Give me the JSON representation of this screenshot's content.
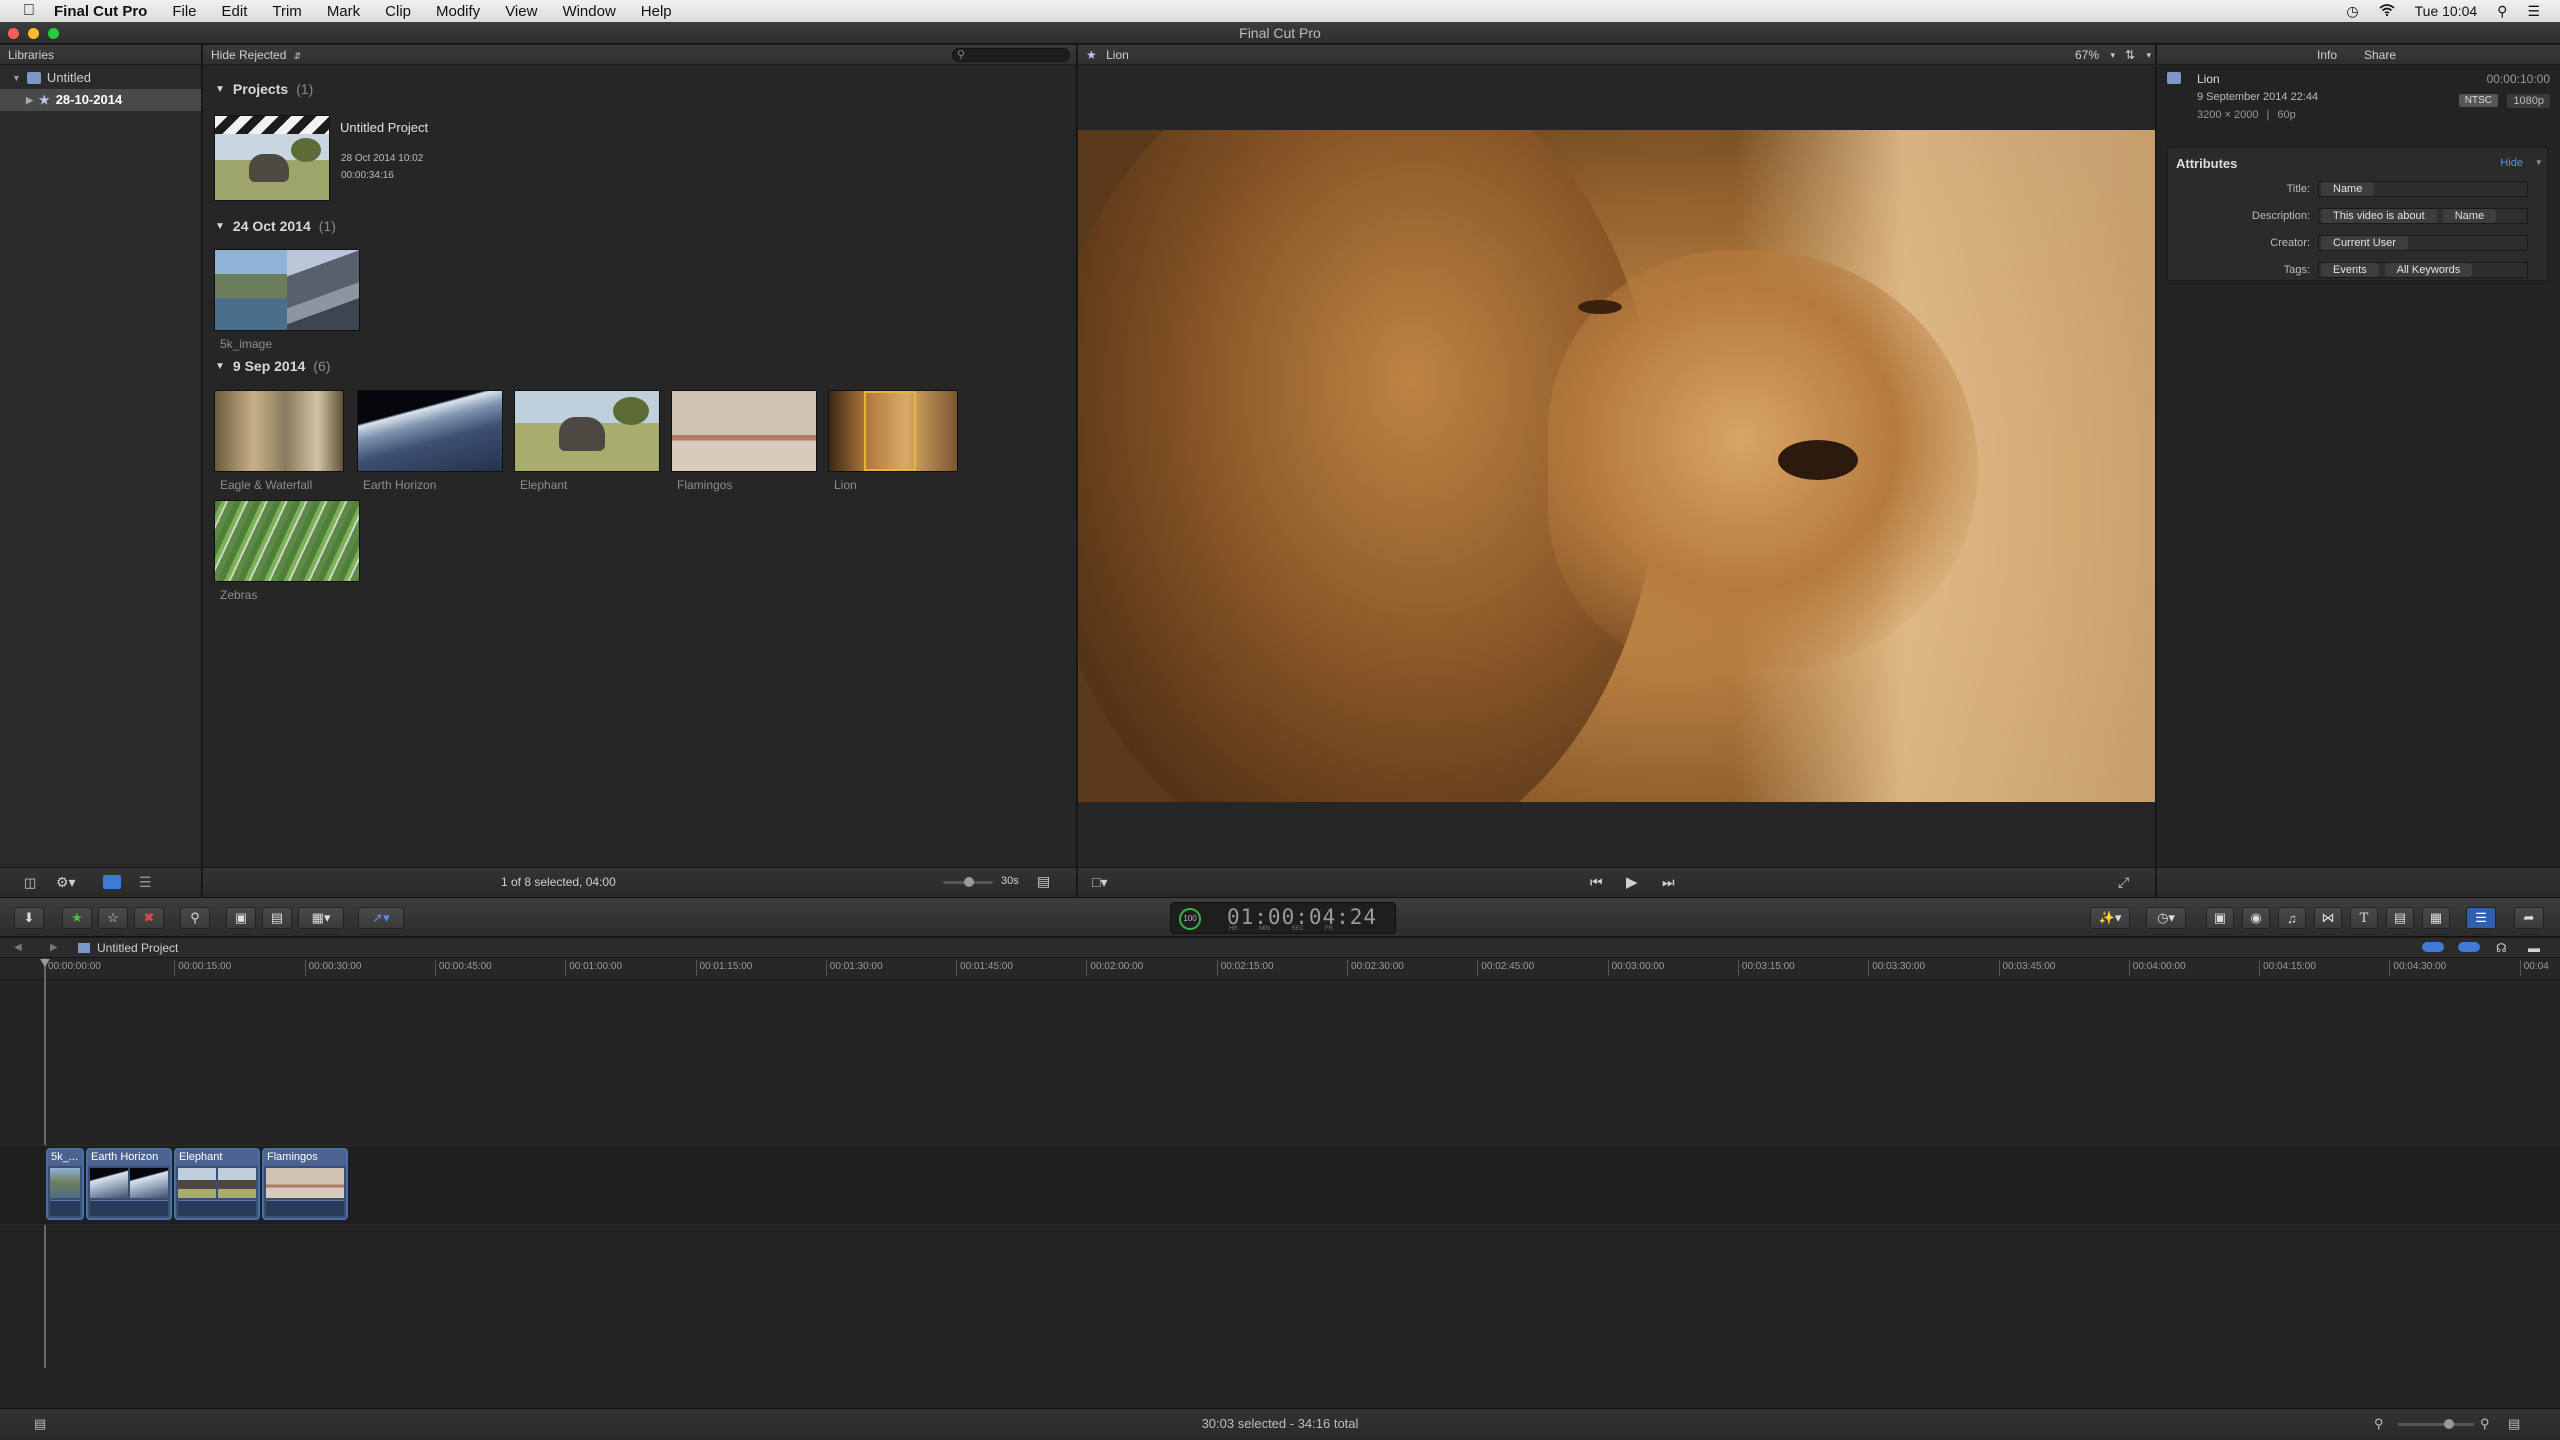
{
  "menubar": {
    "app": "Final Cut Pro",
    "items": [
      "File",
      "Edit",
      "Trim",
      "Mark",
      "Clip",
      "Modify",
      "View",
      "Window",
      "Help"
    ],
    "clock": "Tue 10:04"
  },
  "window": {
    "title": "Final Cut Pro"
  },
  "libraries": {
    "header": "Libraries",
    "library": "Untitled",
    "event": "28-10-2014"
  },
  "browser": {
    "filter": "Hide Rejected",
    "search_placeholder": "",
    "sections": [
      {
        "title": "Projects",
        "count": "(1)"
      },
      {
        "title": "24 Oct 2014",
        "count": "(1)"
      },
      {
        "title": "9 Sep 2014",
        "count": "(6)"
      }
    ],
    "project": {
      "name": "Untitled Project",
      "date": "28 Oct 2014 10:02",
      "duration": "00:00:34:16"
    },
    "clips": [
      "5k_image",
      "Eagle & Waterfall",
      "Earth Horizon",
      "Elephant",
      "Flamingos",
      "Lion",
      "Zebras"
    ],
    "status": "1 of 8 selected, 04:00",
    "zoom_label": "30s"
  },
  "viewer": {
    "clip_name": "Lion",
    "zoom": "67%"
  },
  "inspector": {
    "tabs": [
      "Info",
      "Share"
    ],
    "clip_name": "Lion",
    "duration": "00:00:10:00",
    "date": "9 September 2014 22:44",
    "resolution": "3200 × 2000",
    "fps": "60p",
    "format": "NTSC",
    "format2": "1080p",
    "attributes_title": "Attributes",
    "hide_label": "Hide",
    "rows": [
      {
        "label": "Title:",
        "pills": [
          "Name"
        ]
      },
      {
        "label": "Description:",
        "pills": [
          "This video is about",
          "Name"
        ]
      },
      {
        "label": "Creator:",
        "pills": [
          "Current User"
        ]
      },
      {
        "label": "Tags:",
        "pills": [
          "Events",
          "All Keywords"
        ]
      }
    ]
  },
  "toolbar": {
    "timecode": "01:00:04:24",
    "timecode_units": [
      "HR",
      "MIN",
      "SEC",
      "FR"
    ],
    "progress": "100"
  },
  "timeline": {
    "project": "Untitled Project",
    "ruler": [
      "00:00:00:00",
      "00:00:15:00",
      "00:00:30:00",
      "00:00:45:00",
      "00:01:00:00",
      "00:01:15:00",
      "00:01:30:00",
      "00:01:45:00",
      "00:02:00:00",
      "00:02:15:00",
      "00:02:30:00",
      "00:02:45:00",
      "00:03:00:00",
      "00:03:15:00",
      "00:03:30:00",
      "00:03:45:00",
      "00:04:00:00",
      "00:04:15:00",
      "00:04:30:00",
      "00:04"
    ],
    "clips": [
      {
        "label": "5k_..."
      },
      {
        "label": "Earth Horizon"
      },
      {
        "label": "Elephant"
      },
      {
        "label": "Flamingos"
      }
    ]
  },
  "status": {
    "text": "30:03 selected - 34:16 total"
  },
  "colors": {
    "accent": "#3d7bd6",
    "clip": "#4a6ea8",
    "selection": "#e8b53a"
  }
}
